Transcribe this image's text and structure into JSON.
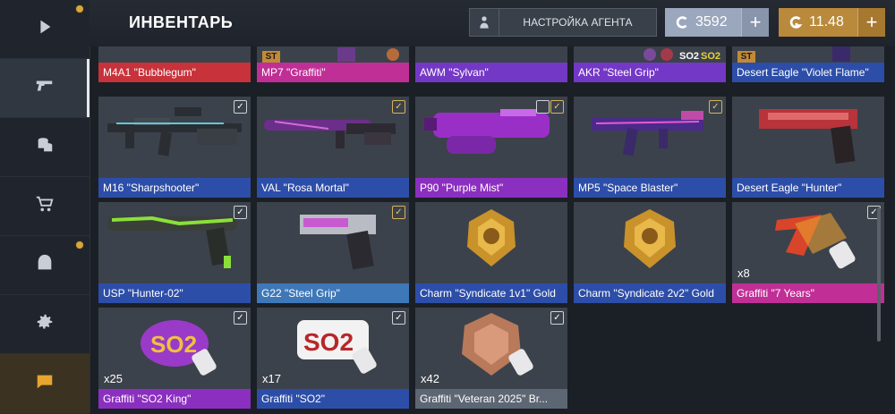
{
  "header": {
    "title": "ИНВЕНТАРЬ",
    "agent_button_label": "НАСТРОЙКА АГЕНТА",
    "silver_amount": "3592",
    "gold_amount": "11.48",
    "plus_symbol": "+"
  },
  "sidebar": {
    "items": [
      {
        "icon": "play-icon",
        "active": false,
        "notification": true
      },
      {
        "icon": "pistol-icon",
        "active": true,
        "notification": false
      },
      {
        "icon": "coins-icon",
        "active": false,
        "notification": false
      },
      {
        "icon": "cart-icon",
        "active": false,
        "notification": false
      },
      {
        "icon": "agent-icon",
        "active": false,
        "notification": true
      },
      {
        "icon": "gear-icon",
        "active": false,
        "notification": false
      },
      {
        "icon": "chat-icon",
        "active": false,
        "notification": false
      }
    ]
  },
  "colors": {
    "rarity_red": "#c8323a",
    "rarity_purple": "#8b2fc0",
    "rarity_pink": "#c02f96",
    "rarity_blue": "#2d4ea8",
    "rarity_lightblue": "#3e78b8",
    "gold_currency": "#b98a3c",
    "silver_currency": "#9aa7bd"
  },
  "cards": [
    {
      "label": "M4A1 \"Bubblegum\""
    },
    {
      "label": "MP7 \"Graffiti\"",
      "badge": "ST"
    },
    {
      "label": "AWM \"Sylvan\""
    },
    {
      "label": "AKR \"Steel Grip\""
    },
    {
      "label": "Desert Eagle \"Violet Flame\"",
      "badge": "ST"
    },
    {
      "label": "M16 \"Sharpshooter\"",
      "check": "✓"
    },
    {
      "label": "VAL \"Rosa Mortal\"",
      "check": "✓"
    },
    {
      "label": "P90 \"Purple Mist\"",
      "check": "✓"
    },
    {
      "label": "MP5 \"Space Blaster\"",
      "check": "✓"
    },
    {
      "label": "Desert Eagle \"Hunter\""
    },
    {
      "label": "USP \"Hunter-02\"",
      "check": "✓"
    },
    {
      "label": "G22 \"Steel Grip\"",
      "check": "✓"
    },
    {
      "label": "Charm \"Syndicate 1v1\" Gold"
    },
    {
      "label": "Charm \"Syndicate 2v2\" Gold"
    },
    {
      "label": "Graffiti \"7 Years\"",
      "quantity": "x8",
      "check": "✓"
    },
    {
      "label": "Graffiti \"SO2 King\"",
      "quantity": "x25",
      "check": "✓"
    },
    {
      "label": "Graffiti \"SO2\"",
      "quantity": "x17",
      "check": "✓"
    },
    {
      "label": "Graffiti \"Veteran 2025\" Br...",
      "quantity": "x42",
      "check": "✓"
    }
  ]
}
